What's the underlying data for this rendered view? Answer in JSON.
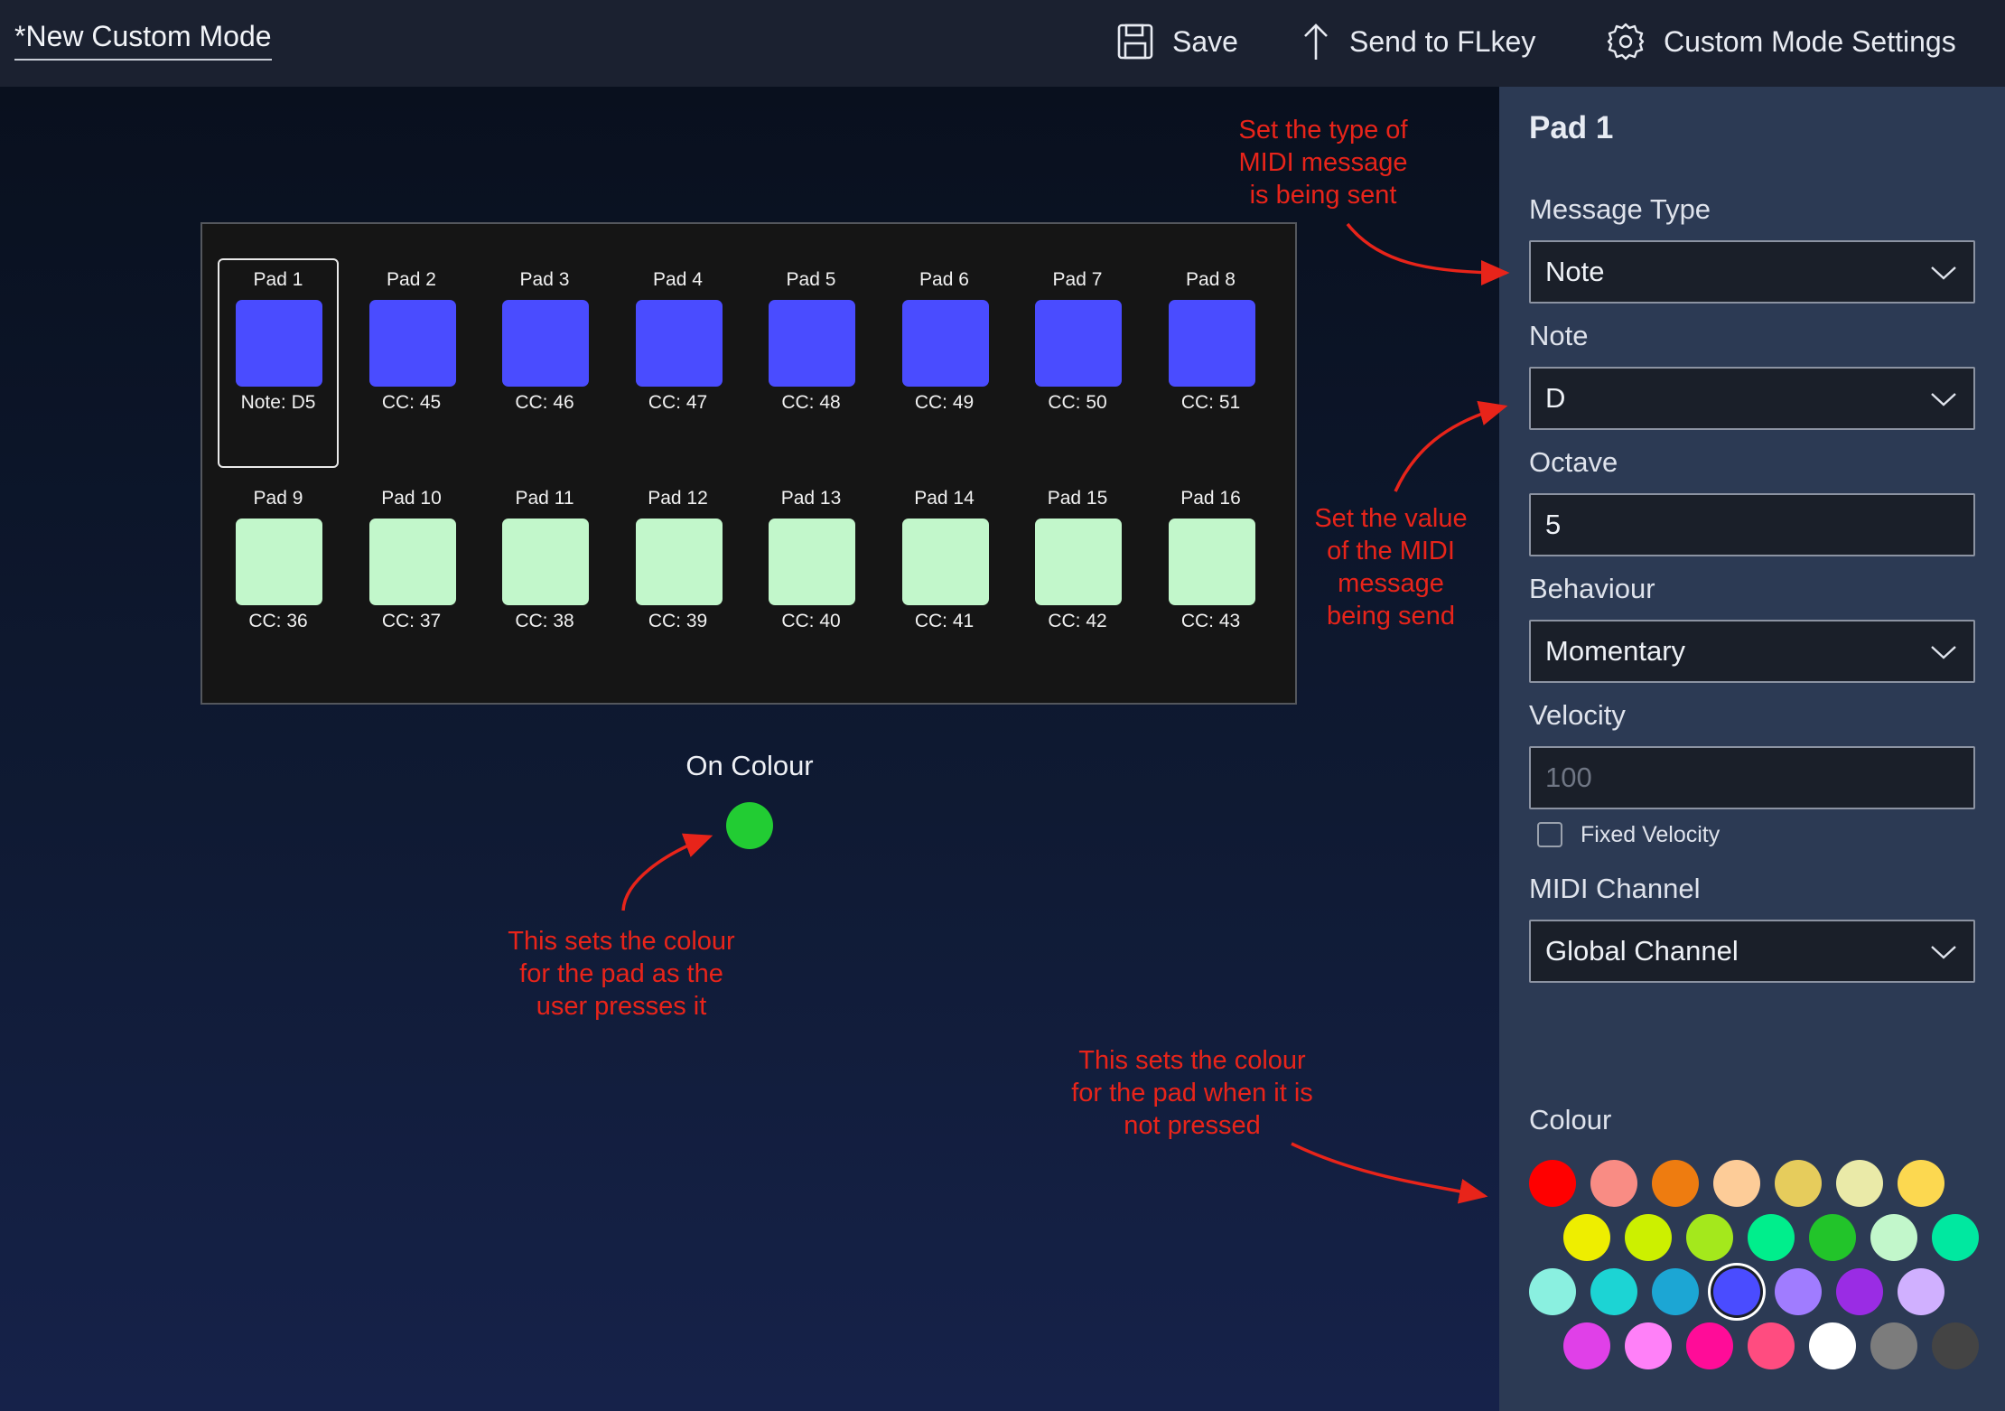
{
  "topbar": {
    "title": "*New Custom Mode",
    "save_label": "Save",
    "send_label": "Send to FLkey",
    "settings_label": "Custom Mode Settings"
  },
  "pads": [
    {
      "name": "Pad 1",
      "value": "Note: D5",
      "color": "#4a4cff",
      "selected": true
    },
    {
      "name": "Pad 2",
      "value": "CC: 45",
      "color": "#4a4cff"
    },
    {
      "name": "Pad 3",
      "value": "CC: 46",
      "color": "#4a4cff"
    },
    {
      "name": "Pad 4",
      "value": "CC: 47",
      "color": "#4a4cff"
    },
    {
      "name": "Pad 5",
      "value": "CC: 48",
      "color": "#4a4cff"
    },
    {
      "name": "Pad 6",
      "value": "CC: 49",
      "color": "#4a4cff"
    },
    {
      "name": "Pad 7",
      "value": "CC: 50",
      "color": "#4a4cff"
    },
    {
      "name": "Pad 8",
      "value": "CC: 51",
      "color": "#4a4cff"
    },
    {
      "name": "Pad 9",
      "value": "CC: 36",
      "color": "#c2f7cb"
    },
    {
      "name": "Pad 10",
      "value": "CC: 37",
      "color": "#c2f7cb"
    },
    {
      "name": "Pad 11",
      "value": "CC: 38",
      "color": "#c2f7cb"
    },
    {
      "name": "Pad 12",
      "value": "CC: 39",
      "color": "#c2f7cb"
    },
    {
      "name": "Pad 13",
      "value": "CC: 40",
      "color": "#c2f7cb"
    },
    {
      "name": "Pad 14",
      "value": "CC: 41",
      "color": "#c2f7cb"
    },
    {
      "name": "Pad 15",
      "value": "CC: 42",
      "color": "#c2f7cb"
    },
    {
      "name": "Pad 16",
      "value": "CC: 43",
      "color": "#c2f7cb"
    }
  ],
  "on_colour": {
    "label": "On Colour",
    "color": "#22cc33"
  },
  "annotations": {
    "message_type": [
      "Set the type of",
      "MIDI message",
      "is being sent"
    ],
    "value": [
      "Set the value",
      "of the MIDI",
      "message",
      "being send"
    ],
    "on_colour": [
      "This sets the colour",
      "for the pad as the",
      "user presses it"
    ],
    "colour": [
      "This sets the colour",
      "for the pad when it is",
      "not pressed"
    ]
  },
  "panel": {
    "title": "Pad 1",
    "message_type": {
      "label": "Message Type",
      "value": "Note"
    },
    "note": {
      "label": "Note",
      "value": "D"
    },
    "octave": {
      "label": "Octave",
      "value": "5"
    },
    "behaviour": {
      "label": "Behaviour",
      "value": "Momentary"
    },
    "velocity": {
      "label": "Velocity",
      "placeholder": "100"
    },
    "fixed_velocity": {
      "label": "Fixed Velocity",
      "checked": false
    },
    "midi_channel": {
      "label": "MIDI Channel",
      "value": "Global Channel"
    },
    "colour_label": "Colour",
    "palette": [
      [
        "#ff0000",
        "#f98c84",
        "#ee7c10",
        "#fdcc98",
        "#e6cc5c",
        "#eaeaa8",
        "#fcd850"
      ],
      [
        "#eeee00",
        "#ccf000",
        "#a4e81c",
        "#00ee8c",
        "#22c42a",
        "#c2f7cb",
        "#00e8a0"
      ],
      [
        "#8af0e0",
        "#1cd4d4",
        "#1ca6d4",
        "#4a4cff",
        "#a07cff",
        "#9a2ce4",
        "#d0b0ff"
      ],
      [
        "#e040e8",
        "#ff80f8",
        "#ff0c98",
        "#ff4c80",
        "#ffffff",
        "#7c7c7c",
        "#444444"
      ]
    ],
    "selected_colour": "#4a4cff"
  }
}
